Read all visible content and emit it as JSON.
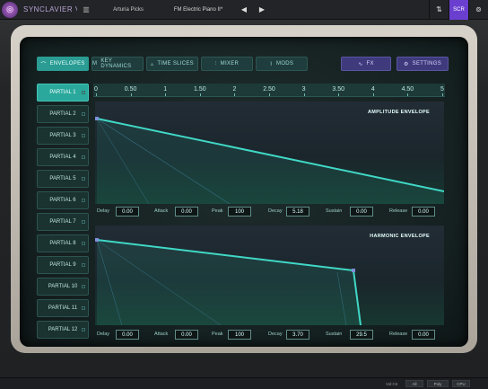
{
  "app": {
    "name": "SYNCLAVIER V",
    "library_icon": "library-icon",
    "author": "Arturia Picks",
    "preset_name": "FM Electric Piano II*",
    "scr_label": "SCR"
  },
  "tabs": [
    {
      "label": "ENVELOPES",
      "icon": "wave-icon"
    },
    {
      "label": "KEY DYNAMICS",
      "icon": "key-icon"
    },
    {
      "label": "TIME SLICES",
      "icon": "slices-icon"
    },
    {
      "label": "MIXER",
      "icon": "mixer-icon"
    },
    {
      "label": "MODS",
      "icon": "mods-icon"
    },
    {
      "label": "FX",
      "icon": "fx-icon"
    },
    {
      "label": "SETTINGS",
      "icon": "gear-icon"
    }
  ],
  "partials": [
    "PARTIAL 1",
    "PARTIAL 2",
    "PARTIAL 3",
    "PARTIAL 4",
    "PARTIAL 5",
    "PARTIAL 6",
    "PARTIAL 7",
    "PARTIAL 8",
    "PARTIAL 9",
    "PARTIAL 10",
    "PARTIAL 11",
    "PARTIAL 12"
  ],
  "ruler": {
    "labels": [
      "0",
      "0.50",
      "1",
      "1.50",
      "2",
      "2.50",
      "3",
      "3.50",
      "4",
      "4.50",
      "5"
    ]
  },
  "amplitude": {
    "title": "AMPLITUDE ENVELOPE",
    "params": [
      {
        "label": "Delay",
        "value": "0.00"
      },
      {
        "label": "Attack",
        "value": "0.00"
      },
      {
        "label": "Peak",
        "value": "100"
      },
      {
        "label": "Decay",
        "value": "5.18"
      },
      {
        "label": "Sustain",
        "value": "0.00"
      },
      {
        "label": "Release",
        "value": "0.00"
      }
    ]
  },
  "harmonic": {
    "title": "HARMONIC ENVELOPE",
    "params": [
      {
        "label": "Delay",
        "value": "0.00"
      },
      {
        "label": "Attack",
        "value": "0.00"
      },
      {
        "label": "Peak",
        "value": "100"
      },
      {
        "label": "Decay",
        "value": "3.70"
      },
      {
        "label": "Sustain",
        "value": "29.5"
      },
      {
        "label": "Release",
        "value": "0.00"
      }
    ]
  },
  "bottom": {
    "left_label": "Vol:C6",
    "box1": "All",
    "box2": "Poly",
    "box3": "CPU"
  },
  "colors": {
    "accent": "#2aa89c",
    "envelope_line": "#40d8c6",
    "fx_tab": "#3e3a7c",
    "scr": "#6a3fd0"
  }
}
